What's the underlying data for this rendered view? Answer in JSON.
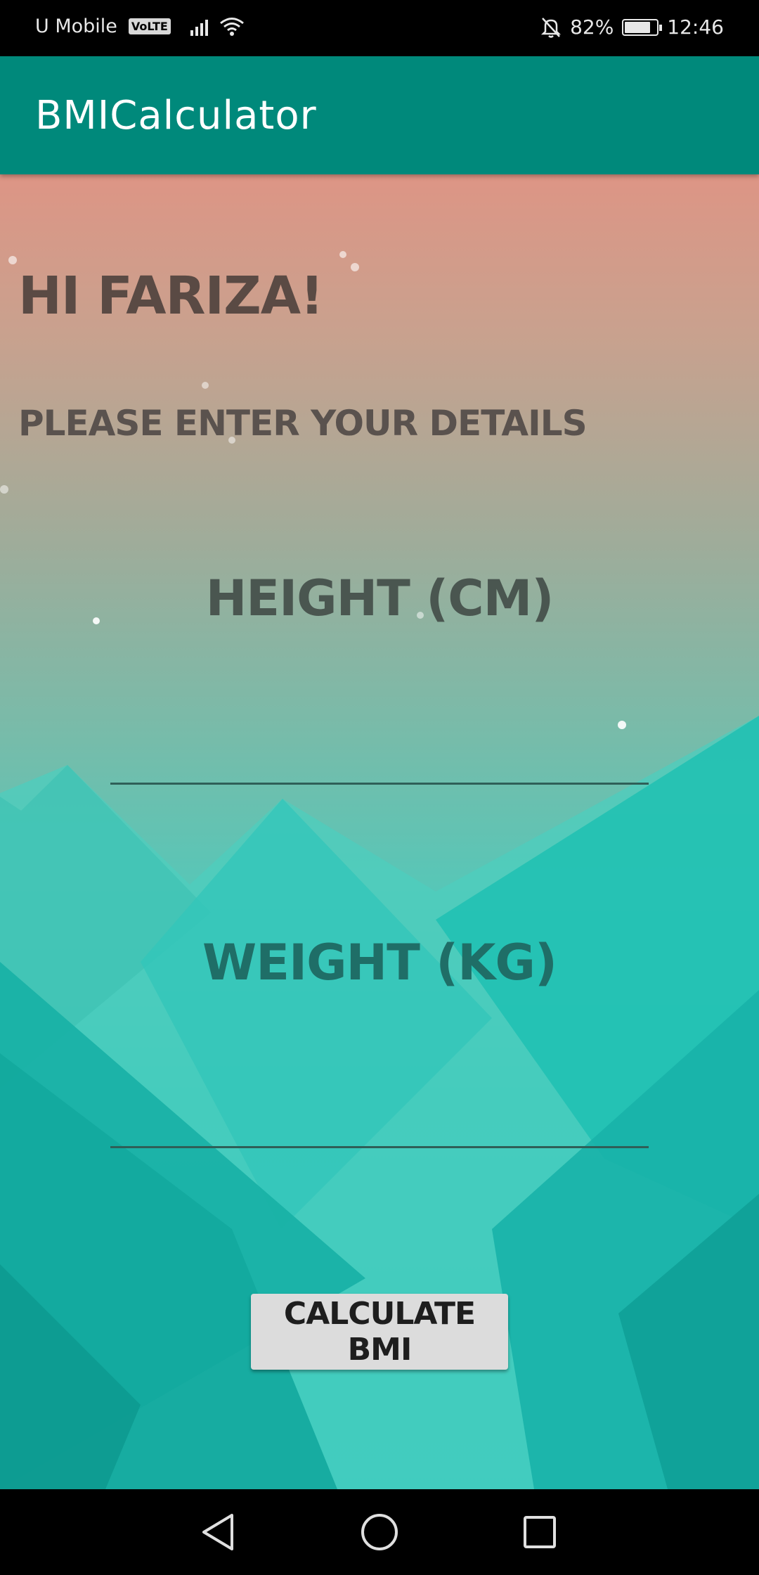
{
  "status_bar": {
    "carrier": "U Mobile",
    "volte_badge": "VoLTE",
    "battery_percent": "82%",
    "time": "12:46",
    "battery_level": 0.82,
    "icons": [
      "signal-bars-icon",
      "wifi-icon",
      "alarm-off-icon",
      "battery-icon"
    ]
  },
  "app_bar": {
    "title": "BMICalculator",
    "color": "#00897b"
  },
  "main": {
    "greeting": "HI FARIZA!",
    "instructions": "PLEASE ENTER YOUR DETAILS",
    "height_label": "HEIGHT (CM)",
    "height_value": "",
    "weight_label": "WEIGHT (KG)",
    "weight_value": "",
    "calculate_button": "CALCULATE BMI"
  },
  "nav_bar": {
    "icons": [
      "back-icon",
      "home-icon",
      "recents-icon"
    ]
  },
  "colors": {
    "background_top": "#dd9585",
    "background_bottom": "#1fc7c1",
    "mountains": "#1ab5aa",
    "button": "#dcdcdc"
  }
}
